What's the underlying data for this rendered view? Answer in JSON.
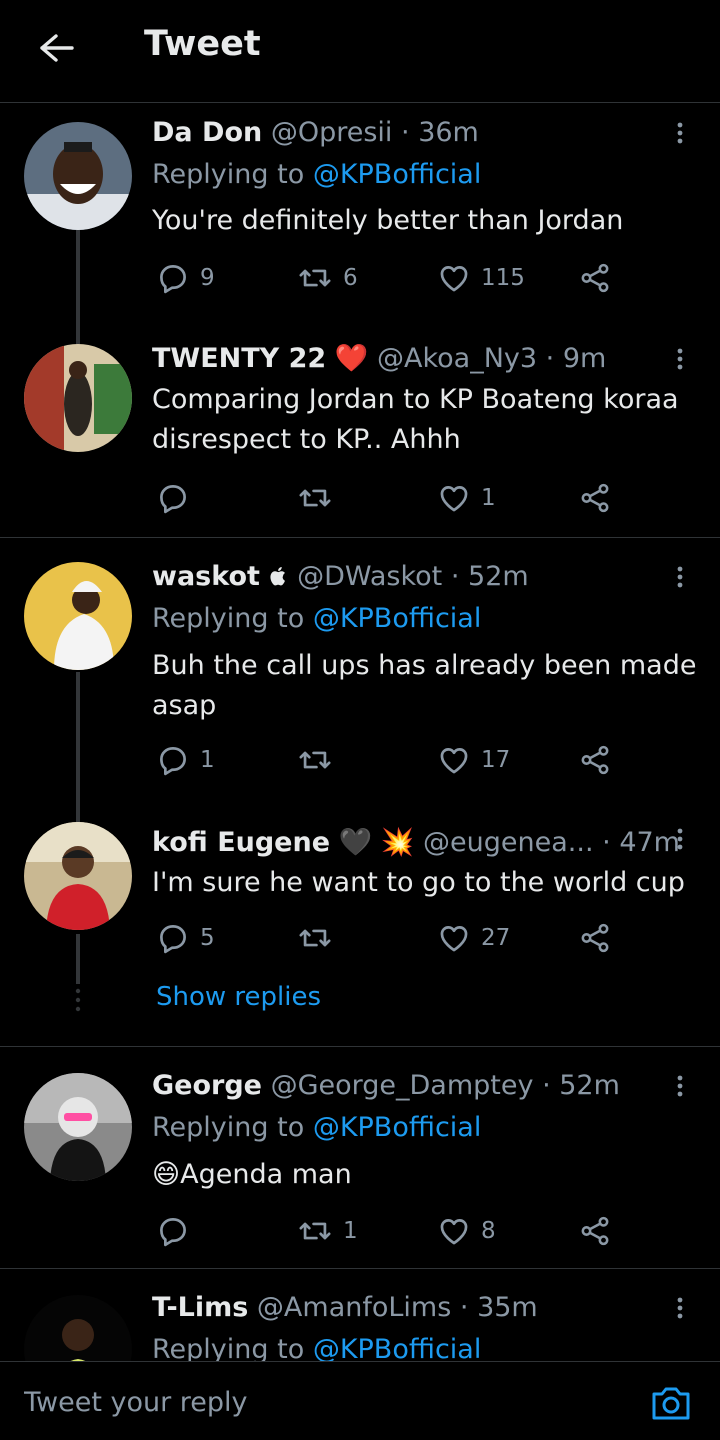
{
  "header": {
    "title": "Tweet"
  },
  "tweets": [
    {
      "name": "Da Don",
      "handle": "@Opresii",
      "time": "36m",
      "replying_label": "Replying to",
      "replying_to": "@KPBofficial",
      "text": "You're definitely better than Jordan",
      "replies": "9",
      "retweets": "6",
      "likes": "115",
      "avatar_color": "#6b7b8c"
    },
    {
      "name": "TWENTY 22",
      "badge": "❤️",
      "handle": "@Akoa_Ny3",
      "time": "9m",
      "text": "Comparing Jordan to KP Boateng koraa disrespect to KP.. Ahhh",
      "replies": "",
      "retweets": "",
      "likes": "1",
      "avatar_color": "#b8a070"
    },
    {
      "name": "waskot",
      "badge": "",
      "handle": "@DWaskot",
      "time": "52m",
      "replying_label": "Replying to",
      "replying_to": "@KPBofficial",
      "text": "Buh the call ups has already been made asap",
      "replies": "1",
      "retweets": "",
      "likes": "17",
      "avatar_color": "#e8c850"
    },
    {
      "name": "kofi Eugene",
      "badge": "🖤 💥",
      "handle": "@eugenea...",
      "time": "47m",
      "text": "I'm sure he want to go to the world cup",
      "replies": "5",
      "retweets": "",
      "likes": "27",
      "avatar_color": "#c4a87a"
    },
    {
      "name": "George",
      "handle": "@George_Damptey",
      "time": "52m",
      "replying_label": "Replying to",
      "replying_to": "@KPBofficial",
      "emoji": "😄",
      "text": "Agenda man",
      "replies": "",
      "retweets": "1",
      "likes": "8",
      "avatar_color": "#9a9a9a"
    },
    {
      "name": "T-Lims",
      "handle": "@AmanfoLims",
      "time": "35m",
      "replying_label": "Replying to",
      "replying_to": "@KPBofficial",
      "avatar_color": "#2a2a2a"
    }
  ],
  "show_replies": "Show replies",
  "separator": "·",
  "reply_bar": {
    "placeholder": "Tweet your reply"
  },
  "colors": {
    "accent": "#1d9bf0",
    "muted": "#8b98a5",
    "text": "#e7e9ea",
    "bg": "#000000",
    "divider": "#2f3336"
  },
  "icons": {
    "back": "arrow-left-icon",
    "more": "more-vertical-icon",
    "reply": "reply-icon",
    "retweet": "retweet-icon",
    "like": "heart-icon",
    "share": "share-icon",
    "camera": "camera-icon"
  }
}
